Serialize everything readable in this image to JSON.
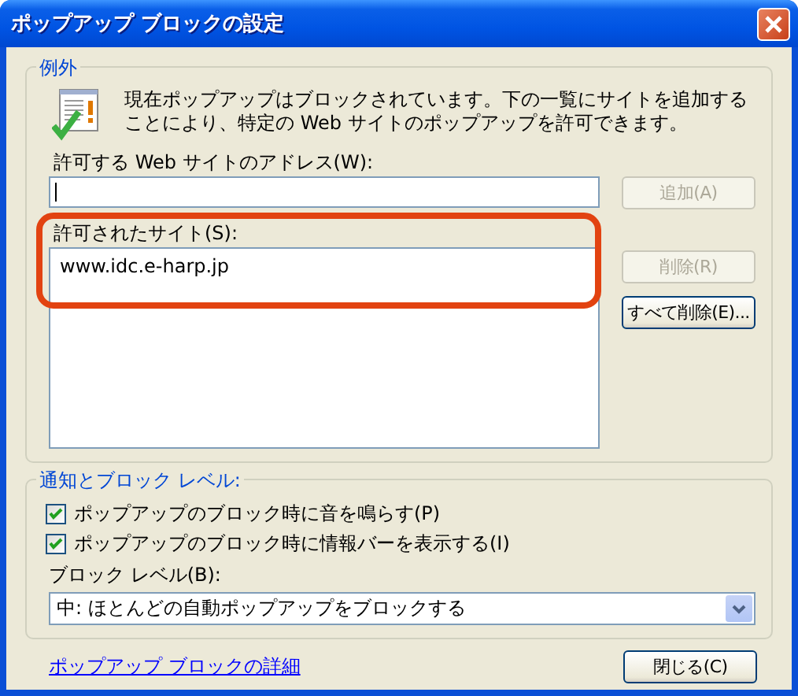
{
  "window": {
    "title": "ポップアップ ブロックの設定"
  },
  "exceptions": {
    "legend": "例外",
    "description": "現在ポップアップはブロックされています。下の一覧にサイトを追加することにより、特定の Web サイトのポップアップを許可できます。",
    "address_label": "許可する Web サイトのアドレス(W):",
    "address_field": {
      "focused": true
    },
    "add_button": {
      "label": "追加(A)",
      "disabled": true
    },
    "allowed_label": "許可されたサイト(S):",
    "allowed_sites": [
      {
        "address": "www.idc.e-harp.jp",
        "selected": false
      }
    ],
    "delete_button": {
      "label": "削除(R)",
      "disabled": true
    },
    "delete_all_button": {
      "label": "すべて削除(E)...",
      "disabled": false
    }
  },
  "notifications": {
    "legend": "通知とブロック レベル:",
    "options": [
      {
        "label": "ポップアップのブロック時に音を鳴らす(P)",
        "checked": true
      },
      {
        "label": "ポップアップのブロック時に情報バーを表示する(I)",
        "checked": true
      }
    ],
    "block_level_label": "ブロック レベル(B):",
    "block_level": "中: ほとんどの自動ポップアップをブロックする"
  },
  "footer": {
    "link": "ポップアップ ブロックの詳細",
    "close_button": {
      "label": "閉じる(C)",
      "disabled": false
    }
  }
}
